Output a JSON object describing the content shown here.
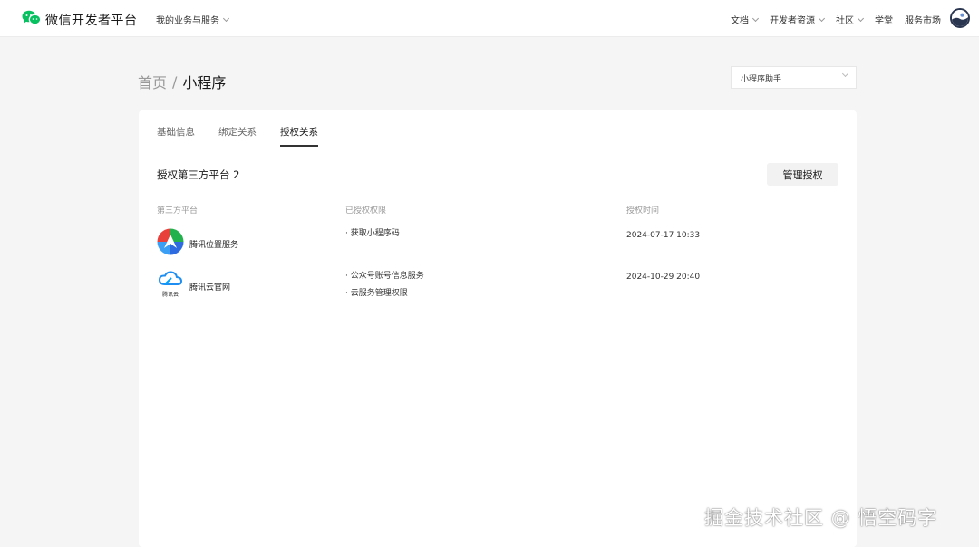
{
  "topbar": {
    "logo_text": "微信开发者平台",
    "services_menu": "我的业务与服务",
    "nav": [
      {
        "label": "文档",
        "has_dropdown": true
      },
      {
        "label": "开发者资源",
        "has_dropdown": true
      },
      {
        "label": "社区",
        "has_dropdown": true
      },
      {
        "label": "学堂",
        "has_dropdown": false
      },
      {
        "label": "服务市场",
        "has_dropdown": false
      }
    ],
    "brand_color": "#07c160"
  },
  "breadcrumb": {
    "home": "首页",
    "separator": "/",
    "current": "小程序"
  },
  "app_select": {
    "value": "小程序助手"
  },
  "tabs": [
    {
      "label": "基础信息",
      "active": false
    },
    {
      "label": "绑定关系",
      "active": false
    },
    {
      "label": "授权关系",
      "active": true
    }
  ],
  "section": {
    "title": "授权第三方平台 2",
    "manage_button": "管理授权"
  },
  "table": {
    "headers": [
      "第三方平台",
      "已授权权限",
      "授权时间"
    ],
    "rows": [
      {
        "platform": "腾讯位置服务",
        "icon": "tencent-map-icon",
        "permissions": [
          "· 获取小程序码"
        ],
        "time": "2024-07-17 10:33"
      },
      {
        "platform": "腾讯云官网",
        "icon": "tencent-cloud-icon",
        "icon_caption": "腾讯云",
        "permissions": [
          "· 公众号账号信息服务",
          "· 云服务管理权限"
        ],
        "time": "2024-10-29 20:40"
      }
    ]
  },
  "watermark": "掘金技术社区 @ 悟空码字"
}
